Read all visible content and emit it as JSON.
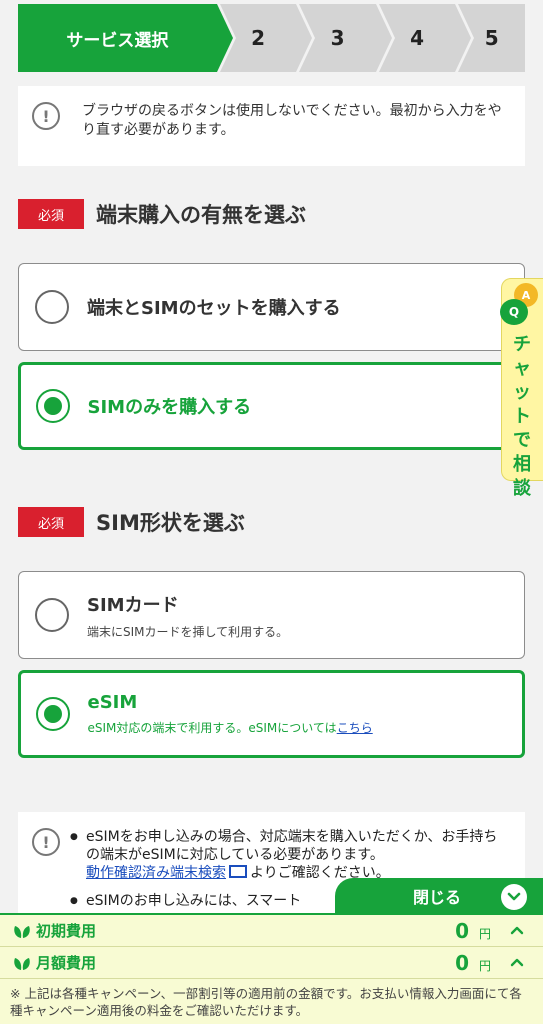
{
  "steps": {
    "active_label": "サービス選択",
    "items": [
      "2",
      "3",
      "4",
      "5"
    ]
  },
  "notice": {
    "text": "ブラウザの戻るボタンは使用しないでください。最初から入力をやり直す必要があります。"
  },
  "section1": {
    "badge": "必須",
    "title": "端末購入の有無を選ぶ",
    "options": [
      {
        "label": "端末とSIMのセットを購入する",
        "selected": false
      },
      {
        "label": "SIMのみを購入する",
        "selected": true
      }
    ]
  },
  "section2": {
    "badge": "必須",
    "title": "SIM形状を選ぶ",
    "options": [
      {
        "label": "SIMカード",
        "desc": "端末にSIMカードを挿して利用する。",
        "selected": false
      },
      {
        "label": "eSIM",
        "desc": "eSIM対応の端末で利用する。eSIMについては",
        "link": "こちら",
        "selected": true
      }
    ]
  },
  "chat": {
    "badge_a": "A",
    "badge_q": "Q",
    "label": "チャットで相談"
  },
  "notice2": {
    "item1_a": "eSIMをお申し込みの場合、対応端末を購入いただくか、お手持ちの端末がeSIMに対応している必要があります。",
    "item1_link": "動作確認済み端末検索",
    "item1_b": "よりご確認ください。",
    "item2": "eSIMのお申し込みには、スマート"
  },
  "close_tab": {
    "label": "閉じる"
  },
  "fees": {
    "initial": {
      "label": "初期費用",
      "value": "0",
      "unit": "円"
    },
    "monthly": {
      "label": "月額費用",
      "value": "0",
      "unit": "円"
    },
    "note": "※ 上記は各種キャンペーン、一部割引等の適用前の金額です。お支払い情報入力画面にて各種キャンペーン適用後の料金をご確認いただけます。"
  },
  "colors": {
    "brand": "#17a33b",
    "required": "#d9202e",
    "link": "#1a4dbd"
  }
}
